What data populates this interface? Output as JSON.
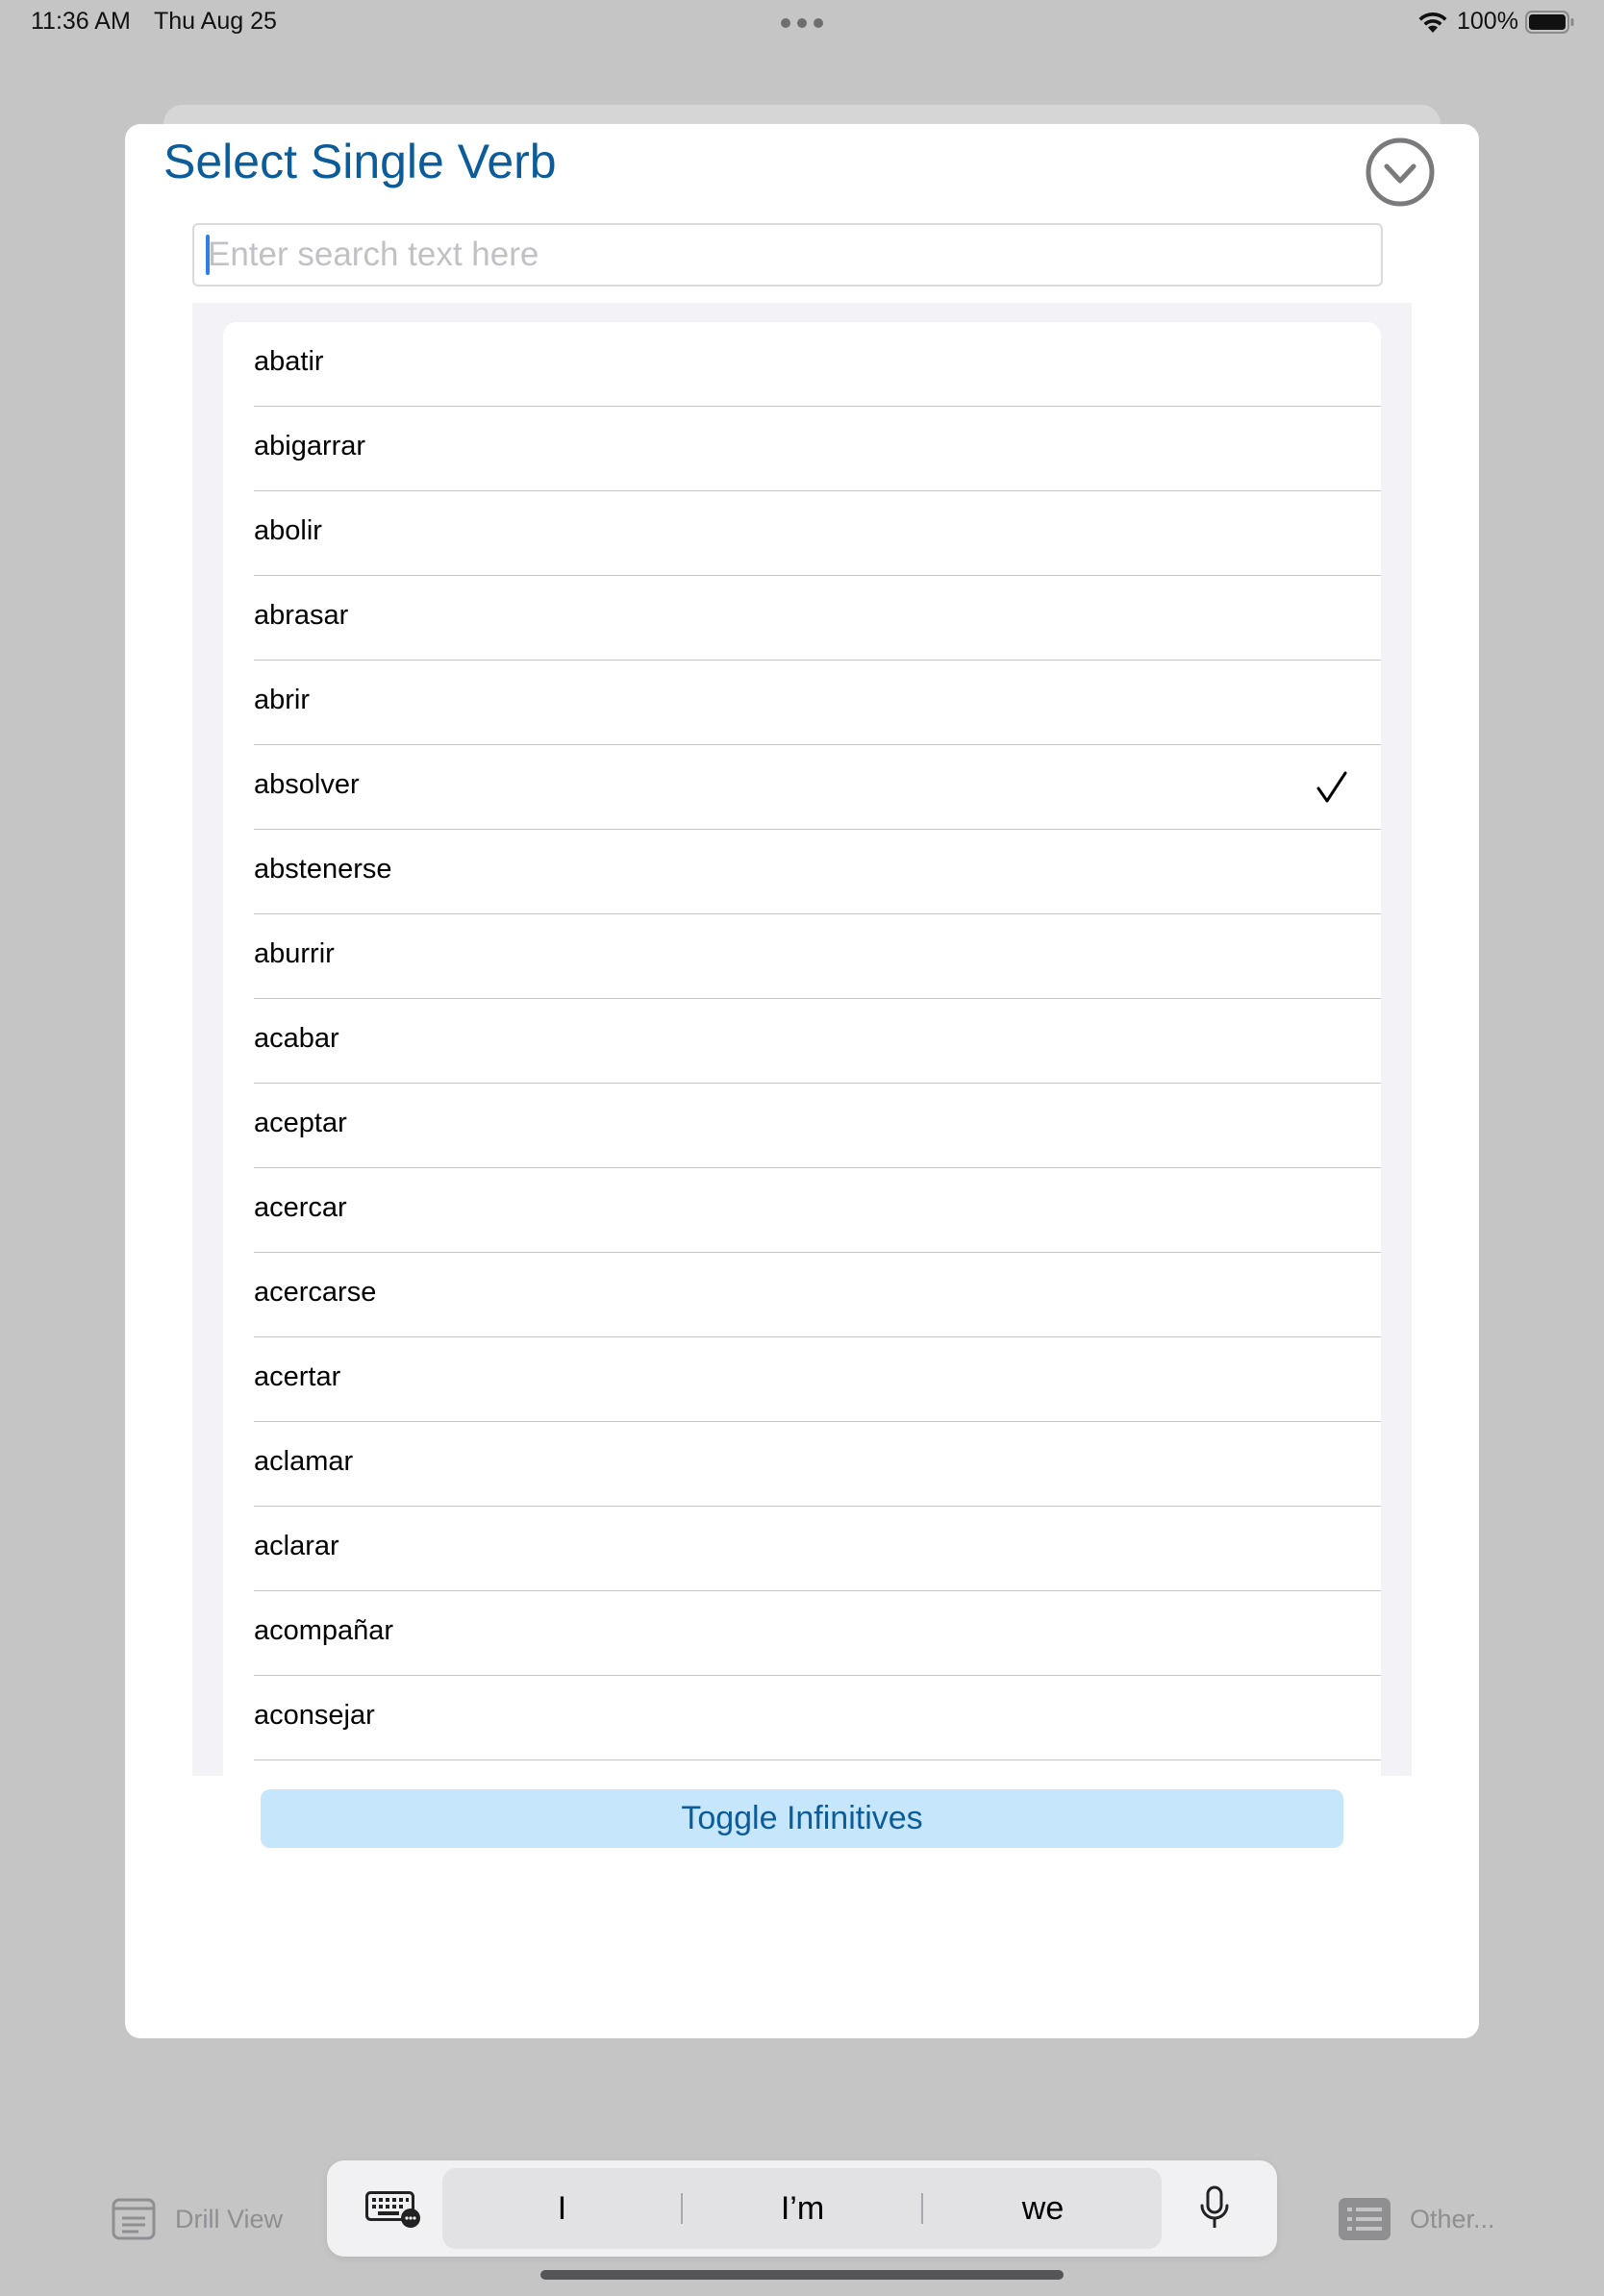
{
  "status_bar": {
    "time": "11:36 AM",
    "date": "Thu Aug 25",
    "battery": "100%"
  },
  "modal": {
    "title": "Select Single Verb",
    "search_placeholder": "Enter search text here",
    "search_value": "",
    "toggle_label": "Toggle Infinitives",
    "verbs": [
      {
        "label": "abatir",
        "checked": false
      },
      {
        "label": "abigarrar",
        "checked": false
      },
      {
        "label": "abolir",
        "checked": false
      },
      {
        "label": "abrasar",
        "checked": false
      },
      {
        "label": "abrir",
        "checked": false
      },
      {
        "label": "absolver",
        "checked": true
      },
      {
        "label": "abstenerse",
        "checked": false
      },
      {
        "label": "aburrir",
        "checked": false
      },
      {
        "label": "acabar",
        "checked": false
      },
      {
        "label": "aceptar",
        "checked": false
      },
      {
        "label": "acercar",
        "checked": false
      },
      {
        "label": "acercarse",
        "checked": false
      },
      {
        "label": "acertar",
        "checked": false
      },
      {
        "label": "aclamar",
        "checked": false
      },
      {
        "label": "aclarar",
        "checked": false
      },
      {
        "label": "acompañar",
        "checked": false
      },
      {
        "label": "aconsejar",
        "checked": false
      }
    ]
  },
  "tab_bar": {
    "left_label": "Drill View",
    "right_label": "Other..."
  },
  "keyboard_bar": {
    "suggestions": [
      "I",
      "I’m",
      "we"
    ]
  },
  "colors": {
    "accent": "#0d5c9a",
    "button_bg": "#c5e6fb",
    "backdrop": "#c5c5c6"
  }
}
